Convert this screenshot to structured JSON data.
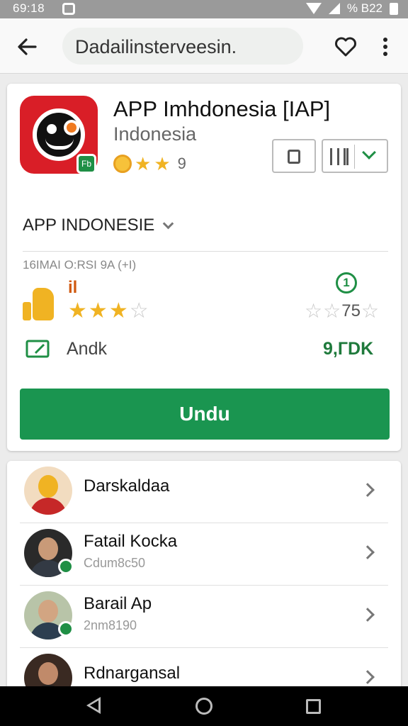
{
  "status": {
    "time": "69:18",
    "battery_text": "%  B22"
  },
  "toolbar": {
    "search_text": "Dadailinsterveesin."
  },
  "app": {
    "title": "APP Imhdonesia [IAP]",
    "subtitle": "Indonesia",
    "rating_value": "9",
    "stars": 3,
    "badge_text": "Fb"
  },
  "details": {
    "section_label": "APP INDONESIE",
    "meta_text": "1​6IMAI O:RSI 9A (+I)",
    "red_mark": "il",
    "stars_filled": 3,
    "stars_total": 4,
    "green_number": "1",
    "right_rating": "75",
    "left_label": "Andk",
    "right_value": "9,ГDK"
  },
  "install_label": "Undu",
  "list": [
    {
      "name": "Darskaldaa",
      "sub": ""
    },
    {
      "name": "Fatail Kocka",
      "sub": "Cdum8c50"
    },
    {
      "name": "Barail Ap",
      "sub": "2nm8190"
    },
    {
      "name": "Rdnargansal",
      "sub": ""
    }
  ],
  "colors": {
    "accent": "#1a9550",
    "app_icon": "#d91e27",
    "star": "#f0b323"
  }
}
